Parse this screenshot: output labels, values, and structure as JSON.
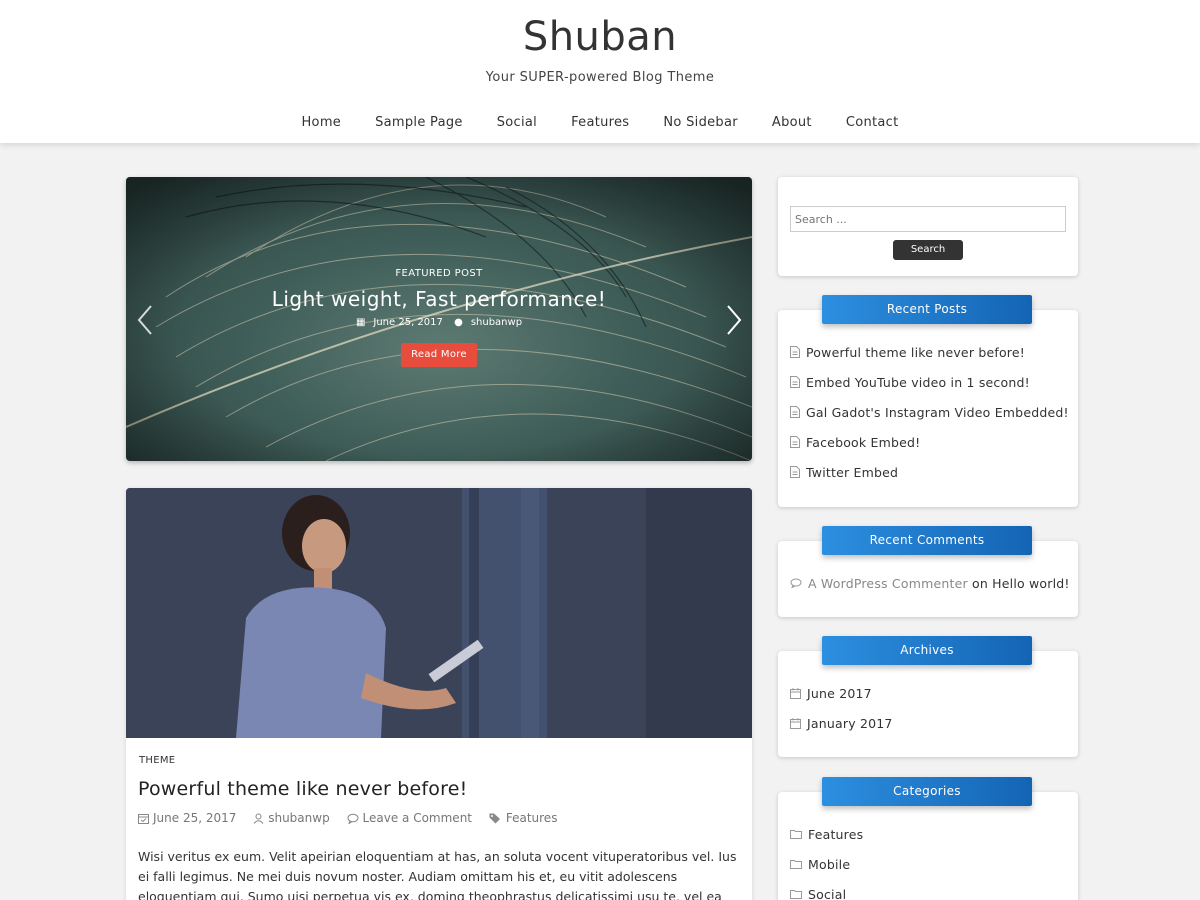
{
  "site": {
    "title": "Shuban",
    "tagline": "Your SUPER-powered Blog Theme"
  },
  "nav": {
    "items": [
      "Home",
      "Sample Page",
      "Social",
      "Features",
      "No Sidebar",
      "About",
      "Contact"
    ]
  },
  "slider": {
    "kicker": "FEATURED POST",
    "title": "Light weight, Fast performance!",
    "date": "June 25, 2017",
    "author": "shubanwp",
    "button": "Read More"
  },
  "post": {
    "category": "THEME",
    "title": "Powerful theme like never before!",
    "date": "June 25, 2017",
    "author": "shubanwp",
    "comments": "Leave a Comment",
    "tag": "Features",
    "excerpt": "Wisi veritus ex eum. Velit apeirian eloquentiam at has, an soluta vocent vituperatoribus vel. Ius ei falli legimus. Ne mei duis novum noster. Audiam omittam his et, eu vitit adolescens eloquentiam qui. Sumo uisi perpetua vis ex, doming theophrastus delicatissimi usu te, vel ea"
  },
  "sidebar": {
    "search": {
      "placeholder": "Search ...",
      "button": "Search"
    },
    "recent_posts": {
      "title": "Recent Posts",
      "items": [
        "Powerful theme like never before!",
        "Embed YouTube video in 1 second!",
        "Gal Gadot's Instagram Video Embedded!",
        "Facebook Embed!",
        "Twitter Embed"
      ]
    },
    "recent_comments": {
      "title": "Recent Comments",
      "author": "A WordPress Commenter",
      "on": "on",
      "post": "Hello world!"
    },
    "archives": {
      "title": "Archives",
      "items": [
        "June 2017",
        "January 2017"
      ]
    },
    "categories": {
      "title": "Categories",
      "items": [
        "Features",
        "Mobile",
        "Social"
      ]
    }
  },
  "colors": {
    "accent_blue": "#1e7bd1",
    "read_more_red": "#e74c3c",
    "page_background": "#f2f2f2"
  }
}
